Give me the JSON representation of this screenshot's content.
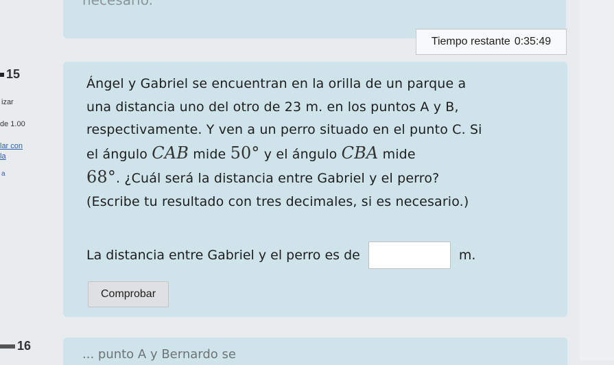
{
  "header": {
    "top_card_text": "necesario.",
    "timer_label": "Tiempo restante",
    "timer_value": "0:35:49"
  },
  "sidebar": {
    "question_number": "15",
    "status_text": "izar",
    "points_text": "de 1.00",
    "flag_line1": "lar con",
    "flag_line2": "la",
    "flag_line3": "a",
    "next_question_number": "16"
  },
  "question": {
    "line1": "Ángel y Gabriel se encuentran en la orilla de un parque a",
    "line2": "una distancia uno del otro de 23 m. en los puntos A y B,",
    "line3": "respectivamente. Y ven a un perro situado en el punto C. Si",
    "line4_a": "el ángulo ",
    "angle1": "CAB",
    "line4_b": " mide ",
    "angle1_value": "50",
    "line4_c": " y el ángulo ",
    "angle2": "CBA",
    "line4_d": " mide",
    "angle2_value": "68",
    "line5": ". ¿Cuál será la distancia entre Gabriel y el perro?",
    "line6": "(Escribe tu resultado con tres decimales, si es necesario.)",
    "degree_symbol": "°"
  },
  "answer": {
    "prefix": "La distancia entre Gabriel y el perro es de",
    "value": "",
    "unit": "m."
  },
  "buttons": {
    "check_label": "Comprobar"
  },
  "next_question": {
    "preview_text": "... punto A y Bernardo se"
  }
}
